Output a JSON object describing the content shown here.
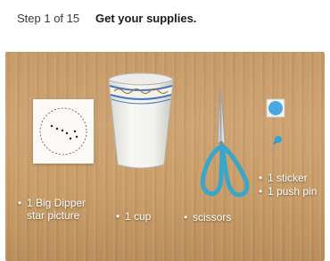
{
  "header": {
    "step_label": "Step 1 of 15",
    "title": "Get your supplies."
  },
  "supplies": [
    {
      "bullet": "•",
      "line1": "1 Big Dipper",
      "line2": "star picture"
    },
    {
      "bullet": "•",
      "line1": "1 cup"
    },
    {
      "bullet": "•",
      "line1": "scissors"
    },
    {
      "bullet": "•",
      "line1": "1 sticker"
    },
    {
      "bullet": "•",
      "line1": "1 push pin"
    }
  ],
  "colors": {
    "table_wood": "#c89f6b",
    "scissor_handle": "#3aa6c9",
    "sticker": "#4aa8e0"
  }
}
